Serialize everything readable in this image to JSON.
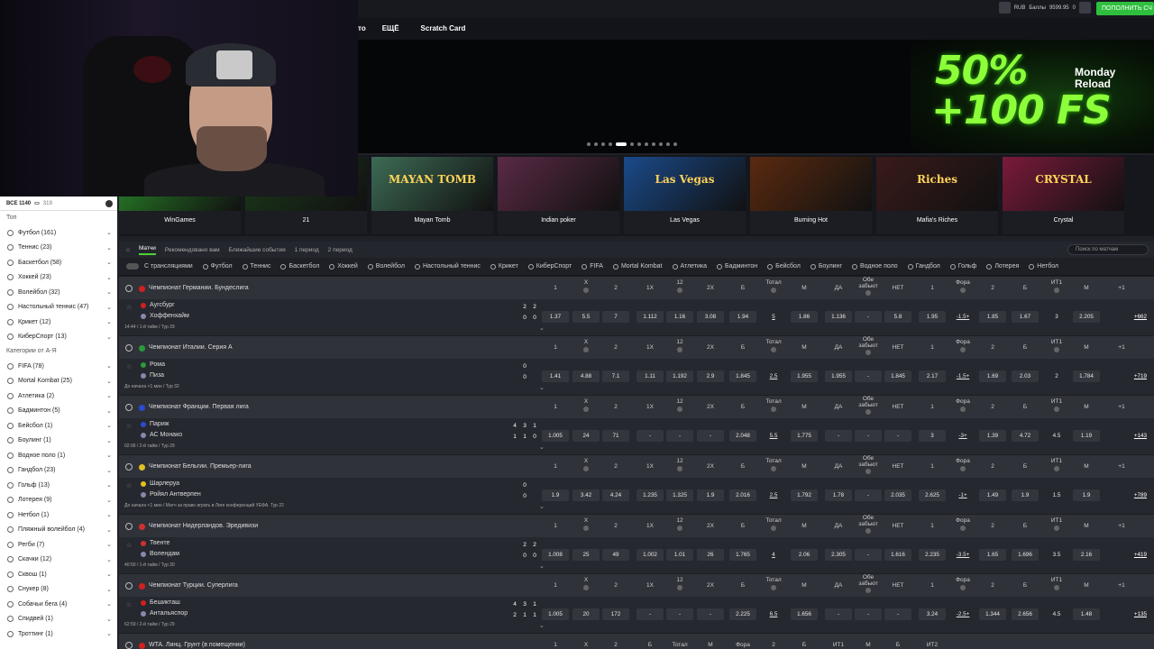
{
  "topnav": {
    "items": [
      "то",
      "ЕЩЁ",
      "Scratch Card"
    ]
  },
  "account": {
    "currency": "RUB",
    "balance": "9599.95",
    "bonus_label": "Баллы",
    "bonus": "0",
    "deposit_label": "ПОПОЛНИТЬ СЧ"
  },
  "hero": {
    "promo_line1": "50%",
    "promo_line2": "+100 FS",
    "promo_small": "Monday Reload",
    "dots": 12,
    "active_dot": 4
  },
  "games": [
    {
      "name": "WinGames",
      "title": "",
      "color": "#2a8a2a"
    },
    {
      "name": "21",
      "title": "21",
      "color": "#1c3a1a"
    },
    {
      "name": "Mayan Tomb",
      "title": "MAYAN TOMB",
      "color": "#3d6b55"
    },
    {
      "name": "Indian poker",
      "title": "",
      "color": "#5a2a45"
    },
    {
      "name": "Las Vegas",
      "title": "Las Vegas",
      "color": "#1a4a8a"
    },
    {
      "name": "Burning Hot",
      "title": "",
      "color": "#5a2a10"
    },
    {
      "name": "Mafia's Riches",
      "title": "Riches",
      "color": "#3a1a1a"
    },
    {
      "name": "Crystal",
      "title": "CRYSTAL",
      "color": "#7a1a3a"
    }
  ],
  "sidebar": {
    "all_label": "ВСЕ 1140",
    "live_count": "319",
    "top_label": "Топ",
    "categories_label": "Категории от А-Я",
    "top_items": [
      "Футбол (161)",
      "Теннис (23)",
      "Баскетбол (58)",
      "Хоккей (23)",
      "Волейбол (32)",
      "Настольный теннис (47)",
      "Крикет (12)",
      "КиберСпорт (13)"
    ],
    "cat_items": [
      "FIFA (78)",
      "Mortal Kombat (25)",
      "Атлетика (2)",
      "Бадминтон (5)",
      "Бейсбол (1)",
      "Боулинг (1)",
      "Водное поло (1)",
      "Гандбол (23)",
      "Гольф (13)",
      "Лотерея (9)",
      "Нетбол (1)",
      "Пляжный волейбол (4)",
      "Регби (7)",
      "Скачки (12)",
      "Сквош (1)",
      "Снукер (8)",
      "Собачьи бега (4)",
      "Спидвей (1)",
      "Троттинг (1)"
    ]
  },
  "tabs": {
    "items": [
      "Матчи",
      "Рекомендовано вам",
      "Ближайшие события",
      "1 период",
      "2 период"
    ],
    "search_placeholder": "Поиск по матчам"
  },
  "filters": {
    "live_label": "С трансляциями",
    "items": [
      "Футбол",
      "Теннис",
      "Баскетбол",
      "Хоккей",
      "Волейбол",
      "Настольный теннис",
      "Крикет",
      "КиберСпорт",
      "FIFA",
      "Mortal Kombat",
      "Атлетика",
      "Бадминтон",
      "Бейсбол",
      "Боулинг",
      "Водное поло",
      "Гандбол",
      "Гольф",
      "Лотерея",
      "Нетбол"
    ]
  },
  "columns": [
    "1",
    "X",
    "2",
    "1X",
    "12",
    "2X",
    "Б",
    "Тотал",
    "М",
    "ДА",
    "Обе забьют",
    "НЕТ",
    "1",
    "Фора",
    "2",
    "Б",
    "ИТ1",
    "М",
    "+1"
  ],
  "leagues": [
    {
      "name": "Чемпионат Германии. Бундеслига",
      "flag": "#d02020",
      "match": {
        "team1": "Аугсбург",
        "team2": "Хоффенхайм",
        "info": "14:44 / 1-й тайм / Тур 29",
        "s1": [
          "2",
          "2"
        ],
        "s2": [
          "0",
          "0"
        ],
        "odds": [
          "1.37",
          "5.5",
          "7",
          "1.112",
          "1.16",
          "3.08",
          "1.94",
          "5",
          "1.86",
          "1.136",
          "-",
          "5.8",
          "1.95",
          "-1.5+",
          "1.85",
          "1.67",
          "3",
          "2.205"
        ],
        "more": "+662"
      }
    },
    {
      "name": "Чемпионат Италии. Серия А",
      "flag": "#2a9a3a",
      "match": {
        "team1": "Рома",
        "team2": "Пиза",
        "info": "До начала <1 мин / Тур 32",
        "s1": [
          "0",
          ""
        ],
        "s2": [
          "0",
          ""
        ],
        "odds": [
          "1.41",
          "4.88",
          "7.1",
          "1.11",
          "1.192",
          "2.9",
          "1.845",
          "2.5",
          "1.955",
          "1.955",
          "-",
          "1.845",
          "2.17",
          "-1.5+",
          "1.69",
          "2.03",
          "2",
          "1.784"
        ],
        "more": "+719"
      }
    },
    {
      "name": "Чемпионат Франции. Первая лига",
      "flag": "#2a4ad0",
      "match": {
        "team1": "Париж",
        "team2": "АС Монако",
        "info": "02:06 / 2-й тайм / Тур 29",
        "s1": [
          "4",
          "3",
          "1"
        ],
        "s2": [
          "1",
          "1",
          "0"
        ],
        "odds": [
          "1.005",
          "24",
          "71",
          "-",
          "-",
          "-",
          "2.048",
          "5.5",
          "1.775",
          "-",
          "-",
          "-",
          "3",
          "-3+",
          "1.39",
          "4.72",
          "4.5",
          "1.19"
        ],
        "more": "+143"
      }
    },
    {
      "name": "Чемпионат Бельгии. Премьер-лига",
      "flag": "#e0c020",
      "match": {
        "team1": "Шарлеруа",
        "team2": "Ройял Антверпен",
        "info": "До начала <1 мин / Матч за право играть в Лиге конференций УЕФА. Тур 22",
        "s1": [
          "0",
          ""
        ],
        "s2": [
          "0",
          ""
        ],
        "odds": [
          "1.9",
          "3.42",
          "4.24",
          "1.235",
          "1.325",
          "1.9",
          "2.016",
          "2.5",
          "1.792",
          "1.78",
          "-",
          "2.035",
          "2.625",
          "-1+",
          "1.49",
          "1.9",
          "1.5",
          "1.9"
        ],
        "more": "+789"
      }
    },
    {
      "name": "Чемпионат Нидерландов. Эредивизи",
      "flag": "#d03030",
      "match": {
        "team1": "Твенте",
        "team2": "Волендам",
        "info": "40:50 / 1-й тайм / Тур 30",
        "s1": [
          "2",
          "2"
        ],
        "s2": [
          "0",
          "0"
        ],
        "odds": [
          "1.008",
          "25",
          "49",
          "1.002",
          "1.01",
          "26",
          "1.765",
          "4",
          "2.06",
          "2.305",
          "-",
          "1.616",
          "2.235",
          "-3.5+",
          "1.65",
          "1.696",
          "3.5",
          "2.16"
        ],
        "more": "+419"
      }
    },
    {
      "name": "Чемпионат Турции. Суперлига",
      "flag": "#d02020",
      "match": {
        "team1": "Бешикташ",
        "team2": "Антальяспор",
        "info": "62:59 / 2-й тайм / Тур 29",
        "s1": [
          "4",
          "3",
          "1"
        ],
        "s2": [
          "2",
          "1",
          "1"
        ],
        "odds": [
          "1.005",
          "20",
          "172",
          "-",
          "-",
          "-",
          "2.225",
          "6.5",
          "1.656",
          "-",
          "-",
          "-",
          "3.24",
          "-2.5+",
          "1.344",
          "2.656",
          "4.5",
          "1.48"
        ],
        "more": "+135"
      }
    }
  ],
  "last_league": {
    "name": "WTA. Линц. Грунт (в помещении)",
    "cols": [
      "1",
      "X",
      "2",
      "Б",
      "Тотал",
      "М",
      "Фора",
      "2",
      "Б",
      "ИТ1",
      "М",
      "Б",
      "ИТ2"
    ]
  }
}
